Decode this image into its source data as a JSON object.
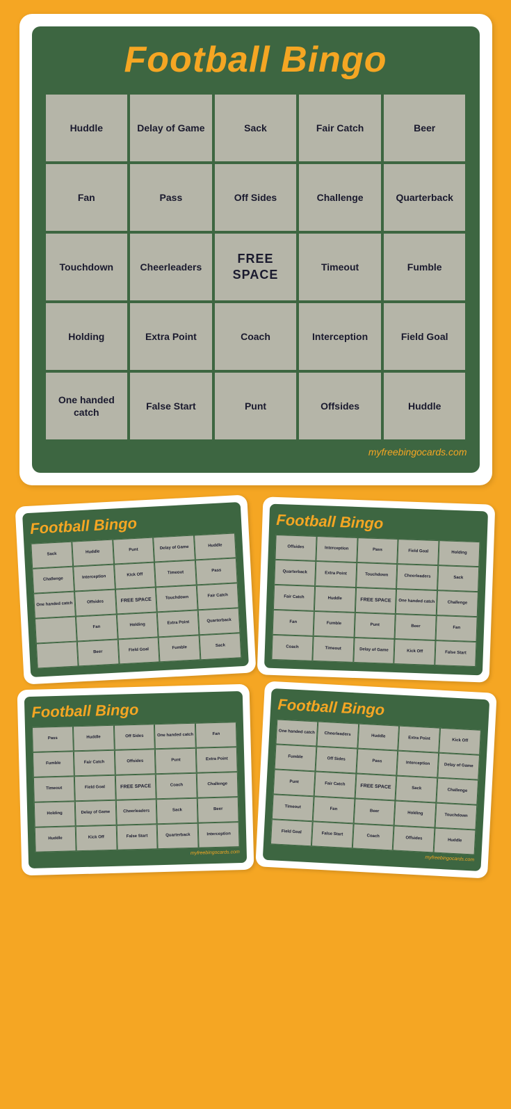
{
  "mainCard": {
    "title": "Football Bingo",
    "website": "myfreebingocards.com",
    "grid": [
      [
        "Huddle",
        "Delay of Game",
        "Sack",
        "Fair Catch",
        "Beer"
      ],
      [
        "Fan",
        "Pass",
        "Off Sides",
        "Challenge",
        "Quarterback"
      ],
      [
        "Touchdown",
        "Cheerleaders",
        "FREE SPACE",
        "Timeout",
        "Fumble"
      ],
      [
        "Holding",
        "Extra Point",
        "Coach",
        "Interception",
        "Field Goal"
      ],
      [
        "One handed catch",
        "False Start",
        "Punt",
        "Offsides",
        "Huddle"
      ]
    ],
    "freeSpaceIndex": "2,2"
  },
  "miniCard1": {
    "title": "Football Bingo",
    "grid": [
      [
        "Sack",
        "Huddle",
        "Punt",
        "Delay of Game",
        "Huddle"
      ],
      [
        "Challenge",
        "Interception",
        "Kick Off",
        "Timeout",
        "Pass"
      ],
      [
        "One handed catch",
        "Offsides",
        "FREE SPACE",
        "Touchdown",
        "Fair Catch"
      ],
      [
        "",
        "",
        "",
        "Fan",
        "Extra Point",
        "Quarterback"
      ],
      [
        "",
        "",
        "",
        "",
        "",
        ""
      ]
    ]
  },
  "miniCard2": {
    "title": "Football Bingo",
    "grid": [
      [
        "Offsides",
        "Interception",
        "Pass",
        "Field Goal",
        "Holding"
      ],
      [
        "Quarterback",
        "Extra Point",
        "Touchdown",
        "Cheerleaders",
        "Sack"
      ],
      [
        "Fair Catch",
        "Huddle",
        "FREE SPACE",
        "One handed catch",
        "Challenge"
      ],
      [
        "",
        "",
        "Punt",
        "Beer",
        "Fan"
      ],
      [
        "",
        "",
        "",
        "",
        ""
      ]
    ]
  },
  "miniCard3": {
    "title": "Football Bingo",
    "grid": [
      [
        "Pass",
        "Huddle",
        "Off Sides",
        "One handed catch",
        "Fan"
      ],
      [
        "Fumble",
        "Fair Catch",
        "Offsides",
        "Punt",
        "Extra Point"
      ],
      [
        "Timeout",
        "Field Goal",
        "FREE SPACE",
        "Coach",
        "Challenge"
      ],
      [
        "Holding",
        "Delay of Game",
        "Cheerleaders",
        "Sack",
        "Beer"
      ],
      [
        "Huddle",
        "Kick Off",
        "False Start",
        "Quarterback",
        "Interception"
      ]
    ]
  },
  "miniCard4": {
    "title": "Football Bingo",
    "grid": [
      [
        "One handed catch",
        "Cheerleaders",
        "Huddle",
        "Extra Point",
        "Kick Off"
      ],
      [
        "Fumble",
        "Off Sides",
        "Pass",
        "Interception",
        "Delay of Game"
      ],
      [
        "Punt",
        "Fair Catch",
        "FREE SPACE",
        "Sack",
        "Challenge"
      ],
      [
        "Timeout",
        "Fan",
        "Beer",
        "Holding",
        "Touchdown"
      ],
      [
        "Field Goal",
        "False Start",
        "Coach",
        "Offsides",
        "Huddle"
      ]
    ]
  }
}
